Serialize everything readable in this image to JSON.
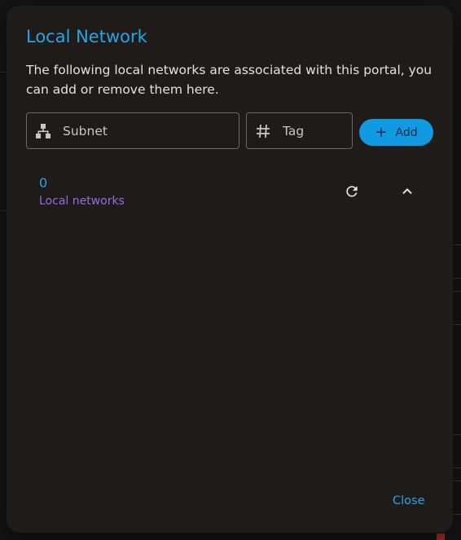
{
  "dialog": {
    "title": "Local Network",
    "description": "The following local networks are associated with this portal, you can add or remove them here.",
    "subnet_placeholder": "Subnet",
    "tag_placeholder": "Tag",
    "add_label": "Add",
    "count": "0",
    "count_label": "Local networks",
    "close_label": "Close"
  },
  "icons": {
    "subnet": "network-tree-icon",
    "tag": "hash-icon",
    "add": "plus-icon",
    "refresh": "refresh-icon",
    "collapse": "chevron-up-icon"
  },
  "colors": {
    "accent": "#2aa4e8",
    "button_fill": "#0f9ae2",
    "secondary_text": "#9a6ae0",
    "dialog_bg": "#1e1b19"
  }
}
